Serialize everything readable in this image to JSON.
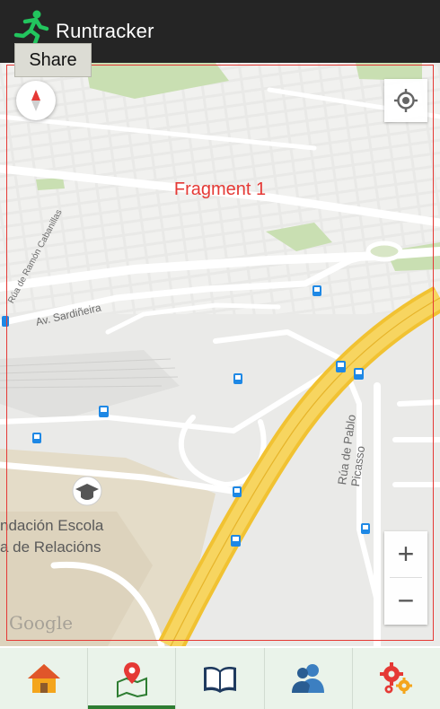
{
  "app": {
    "title": "Runtracker",
    "logo_icon": "runner-icon",
    "accent_color": "#1db954"
  },
  "tooltip": {
    "text": "Share"
  },
  "map": {
    "fragment_label": "Fragment 1",
    "places": {
      "school_line1": "ndación Escola",
      "school_line2": "a de Relacións"
    },
    "streets": {
      "street_a": "Av. Sardiñeira",
      "street_b": "Rúa de Pablo Picasso",
      "street_c": "Rúa de Ramón Cabanillas"
    },
    "attribution": "Google",
    "zoom_in": "+",
    "zoom_out": "−"
  },
  "bottom_nav": {
    "items": [
      {
        "name": "home",
        "icon": "home-icon"
      },
      {
        "name": "map",
        "icon": "map-pin-icon",
        "active": true
      },
      {
        "name": "book",
        "icon": "book-icon"
      },
      {
        "name": "contacts",
        "icon": "users-icon"
      },
      {
        "name": "settings",
        "icon": "gears-icon"
      }
    ]
  }
}
